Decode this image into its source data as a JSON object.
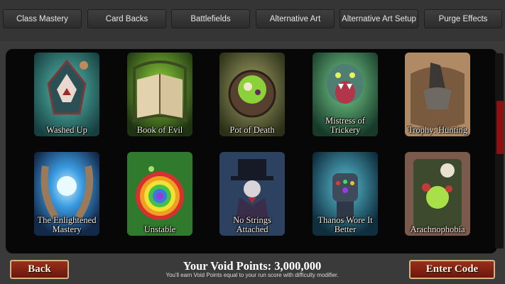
{
  "tabs": [
    {
      "label": "Class Mastery"
    },
    {
      "label": "Card Backs"
    },
    {
      "label": "Battlefields"
    },
    {
      "label": "Alternative Art"
    },
    {
      "label": "Alternative Art Setup"
    },
    {
      "label": "Purge Effects"
    }
  ],
  "cards": [
    {
      "label": "Washed Up",
      "icon": "hooded-figure-icon",
      "color": "#3f9e96"
    },
    {
      "label": "Book of Evil",
      "icon": "open-book-icon",
      "color": "#4d7a24"
    },
    {
      "label": "Pot of Death",
      "icon": "cauldron-icon",
      "color": "#5f6a38"
    },
    {
      "label": "Mistress of Trickery",
      "icon": "serpent-icon",
      "color": "#3f8a62"
    },
    {
      "label": "Trophy: Hunting",
      "icon": "horn-trophy-icon",
      "color": "#8a6d4e"
    },
    {
      "label": "The Enlightened Mastery",
      "icon": "glowing-orb-icon",
      "color": "#2d6fa0"
    },
    {
      "label": "Unstable",
      "icon": "rainbow-vortex-icon",
      "color": "#2f7a2c"
    },
    {
      "label": "No Strings Attached",
      "icon": "top-hat-puppeteer-icon",
      "color": "#3e5c7a"
    },
    {
      "label": "Thanos Wore It Better",
      "icon": "gauntlet-icon",
      "color": "#2a6e86"
    },
    {
      "label": "Arachnophobia",
      "icon": "skull-spider-icon",
      "color": "#8a5a4a"
    }
  ],
  "footer": {
    "back_label": "Back",
    "enter_code_label": "Enter Code",
    "void_points": "Your Void Points: 3,000,000",
    "void_note": "You'll earn Void Points equal to your run score with difficulty modifier."
  }
}
